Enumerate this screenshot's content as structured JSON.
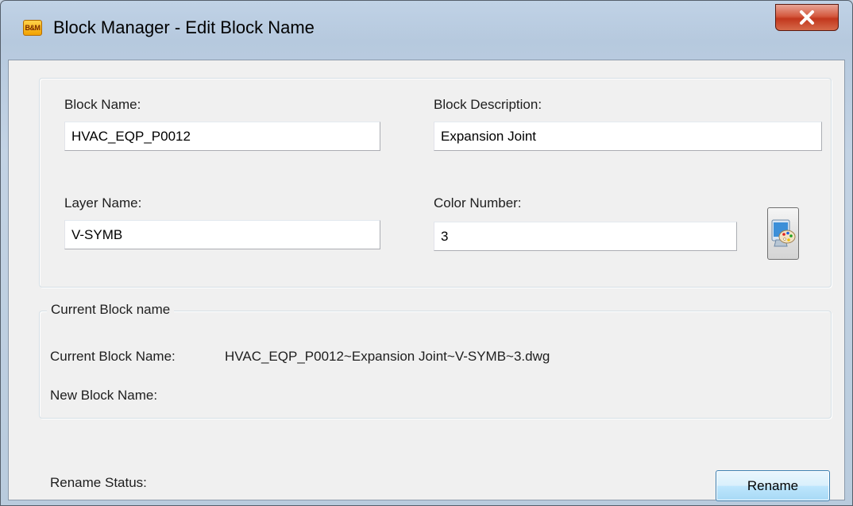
{
  "window": {
    "title": "Block Manager - Edit Block Name",
    "app_icon_text": "B&M"
  },
  "fields": {
    "block_name": {
      "label": "Block Name:",
      "value": "HVAC_EQP_P0012"
    },
    "block_description": {
      "label": "Block Description:",
      "value": "Expansion Joint"
    },
    "layer_name": {
      "label": "Layer Name:",
      "value": "V-SYMB"
    },
    "color_number": {
      "label": "Color Number:",
      "value": "3"
    }
  },
  "current_block": {
    "group_title": "Current Block name",
    "current_label": "Current Block Name:",
    "current_value": "HVAC_EQP_P0012~Expansion Joint~V-SYMB~3.dwg",
    "new_label": "New Block Name:"
  },
  "footer": {
    "status_label": "Rename Status:",
    "rename_button": "Rename"
  },
  "icons": {
    "app": "app-icon",
    "close": "close-icon",
    "color_picker": "color-palette-icon"
  },
  "colors": {
    "close_button": "#c2371d",
    "button_highlight": "#bee6fd",
    "dialog_background": "#f0f0f0"
  }
}
